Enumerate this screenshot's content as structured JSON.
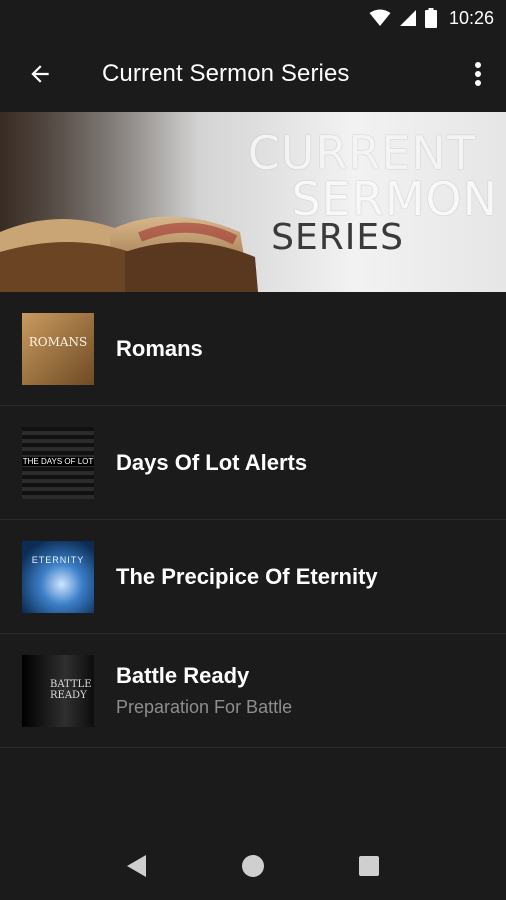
{
  "status_bar": {
    "time": "10:26",
    "icons": [
      "wifi-icon",
      "signal-icon",
      "battery-icon"
    ]
  },
  "app_bar": {
    "title": "Current Sermon Series",
    "back_icon": "arrow-back-icon",
    "menu_icon": "more-vert-icon"
  },
  "banner": {
    "line1": "CURRENT",
    "line2": "SERMON",
    "line3": "SERIES"
  },
  "series": [
    {
      "title": "Romans",
      "subtitle": "",
      "thumb_text": "ROMANS"
    },
    {
      "title": "Days Of Lot Alerts",
      "subtitle": "",
      "thumb_text": "THE DAYS OF LOT"
    },
    {
      "title": "The Precipice Of Eternity",
      "subtitle": "",
      "thumb_text": "ETERNITY"
    },
    {
      "title": "Battle Ready",
      "subtitle": "Preparation For Battle",
      "thumb_text": "BATTLE READY"
    }
  ],
  "nav_bar": {
    "icons": [
      "back-triangle-icon",
      "home-circle-icon",
      "recents-square-icon"
    ]
  }
}
